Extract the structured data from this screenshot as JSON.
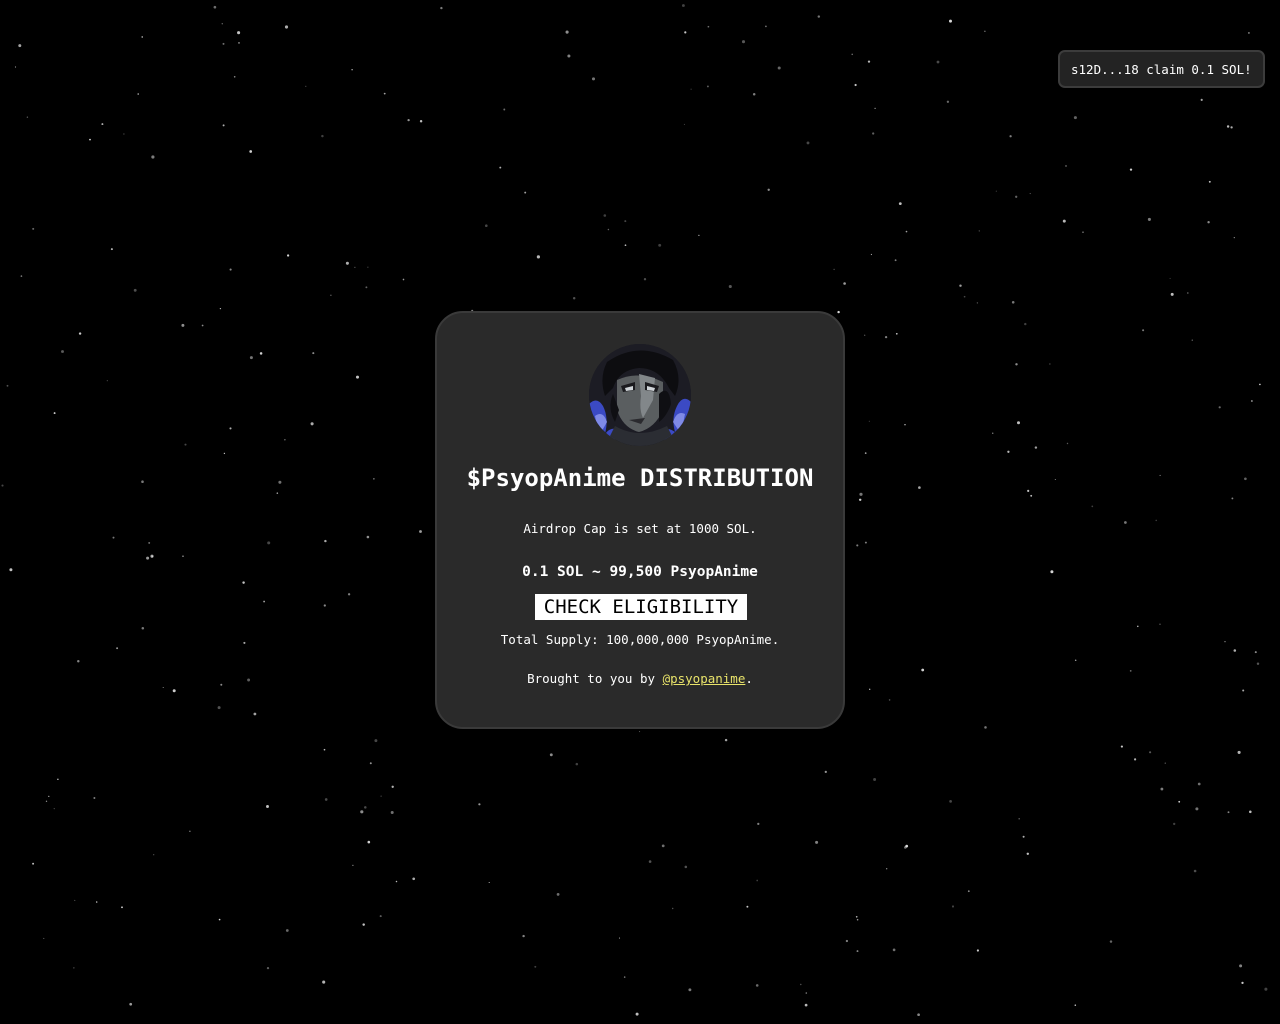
{
  "notification": {
    "text": "s12D...18 claim 0.1 SOL!"
  },
  "card": {
    "avatar_alt": "anime-character-avatar",
    "title": "$PsyopAnime DISTRIBUTION",
    "cap_text": "Airdrop Cap is set at 1000 SOL.",
    "rate_text": "0.1 SOL ~ 99,500 PsyopAnime",
    "check_button_label": "CHECK ELIGIBILITY",
    "supply_text": "Total Supply: 100,000,000 PsyopAnime.",
    "credit_prefix": "Brought to you by ",
    "credit_link": "@psyopanime",
    "credit_suffix": "."
  },
  "colors": {
    "background": "#000000",
    "card": "#2a2a2a",
    "link": "#e8e36a",
    "button_bg": "#ffffff",
    "button_text": "#000000"
  }
}
